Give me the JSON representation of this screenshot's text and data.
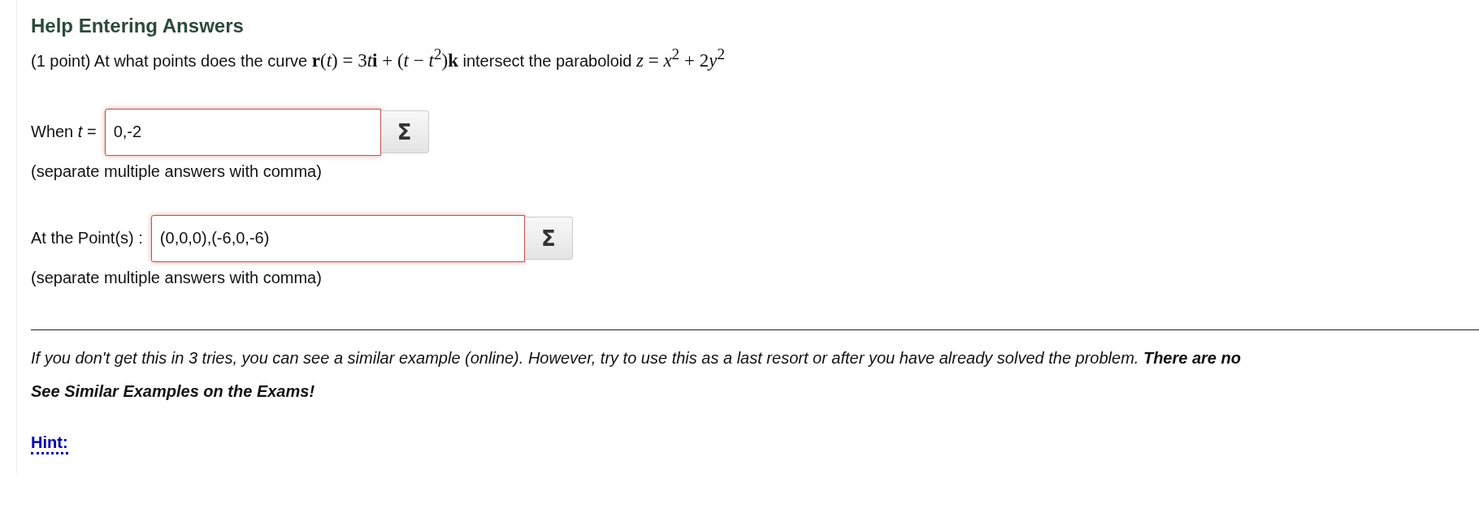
{
  "title": "Help Entering Answers",
  "question": [
    {
      "kind": "text",
      "text": "(1 point) At what points does the curve "
    },
    {
      "kind": "math",
      "text": "**r**(*t*) = 3"
    },
    {
      "kind": "math",
      "text": "*t*"
    },
    {
      "kind": "math",
      "text": "**i** + (*t* − *t*$^{2}$)**k**"
    },
    {
      "kind": "text",
      "text": " intersect the paraboloid "
    },
    {
      "kind": "math",
      "text": "*z* = *x*$^{2}$ + 2"
    },
    {
      "kind": "math",
      "text": "*y*$^{2}$"
    }
  ],
  "answers": [
    {
      "label": "When *t* =",
      "value": "0,-2",
      "incorrect": true,
      "button": "Σ",
      "note": "(separate multiple answers with comma)"
    },
    {
      "label": "At the Point(s) :",
      "value": "(0,0,0),(-6,0,-6)",
      "incorrect": true,
      "button": "Σ",
      "note": "(separate multiple answers with comma)"
    }
  ],
  "notice": "If you don't get this in 3 tries, you can see a similar example (online). However, try to use this as a last resort or after you have already solved the problem. **There are no See Similar Examples on the Exams!**",
  "hint": "Hint:"
}
